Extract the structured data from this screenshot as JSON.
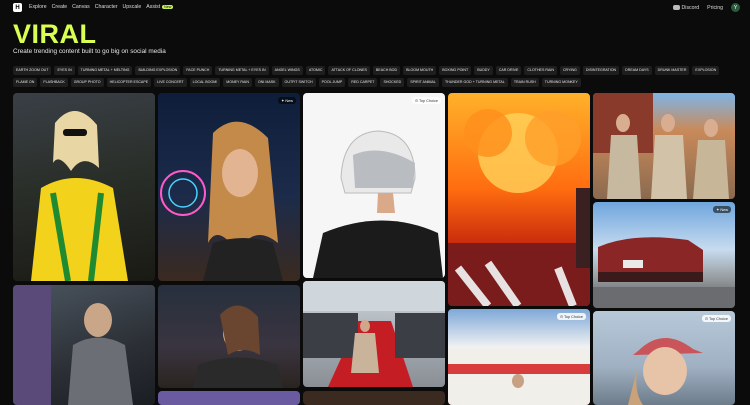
{
  "nav": {
    "items": [
      "Explore",
      "Create",
      "Canvas",
      "Character",
      "Upscale",
      "Assist"
    ],
    "assist_badge": "New",
    "discord": "Discord",
    "pricing": "Pricing",
    "avatar_initial": "Y"
  },
  "hero": {
    "title": "VIRAL",
    "subtitle": "Create trending content built to go big on social media"
  },
  "chips": [
    "Earth Zoom Out",
    "Eyes In",
    "Turning Metal + Melting",
    "Building Explosion",
    "Face Punch",
    "Turning Metal + Eyes In",
    "Angel Wings",
    "Atomic",
    "Attack of Clones",
    "Beach Bod",
    "Bloom Mouth",
    "Boxing Point",
    "Buddy",
    "Car Drive",
    "Clothes Rain",
    "Crying",
    "Disintegration",
    "Dream Days",
    "Drunk Master",
    "Explosion",
    "Flame On",
    "Flashback",
    "Group Photo",
    "Helicopter Escape",
    "Live Concert",
    "Local Boom!",
    "Money Rain",
    "Oni Mask",
    "Outfit Switch",
    "Pool Jump",
    "Red Carpet",
    "Shocked",
    "Spirit Animal",
    "Thunder God + Turning Metal",
    "Train Rush",
    "Turning Monkey"
  ],
  "cards": {
    "new_tag": "New",
    "top_choice": "Top Choice",
    "top_choice2": "Top Choice",
    "top_choice3": "Top Choice",
    "new_tag2": "New"
  }
}
